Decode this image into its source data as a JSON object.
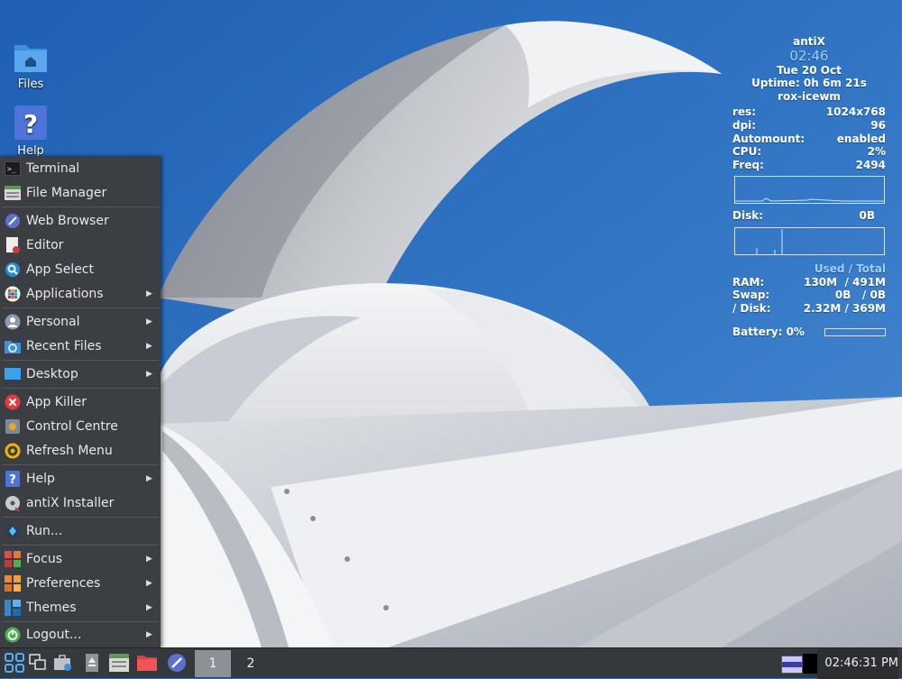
{
  "desktop": {
    "icons": [
      {
        "label": "Files",
        "icon": "folder-home-icon"
      },
      {
        "label": "Help",
        "icon": "help-icon"
      }
    ]
  },
  "conky": {
    "hostname": "antiX",
    "time": "02:46",
    "date": "Tue 20 Oct",
    "uptime": "Uptime: 0h 6m 21s",
    "wm": "rox-icewm",
    "stats": [
      {
        "label": "res:",
        "value": "1024x768"
      },
      {
        "label": "dpi:",
        "value": "96"
      },
      {
        "label": "Automount:",
        "value": "enabled"
      },
      {
        "label": "CPU:",
        "value": "2%"
      },
      {
        "label": "Freq:",
        "value": "2494"
      }
    ],
    "disk": {
      "label": "Disk:",
      "value": "0B"
    },
    "used_total": "Used / Total",
    "memory": [
      {
        "label": "RAM:",
        "value": "130M  / 491M"
      },
      {
        "label": "Swap:",
        "value": "0B   / 0B"
      },
      {
        "label": "/ Disk:",
        "value": "2.32M / 369M"
      }
    ],
    "battery": {
      "label": "Battery: 0%",
      "level": 0
    }
  },
  "menu": {
    "items": [
      {
        "label": "Terminal",
        "icon": "terminal-icon",
        "submenu": false
      },
      {
        "label": "File Manager",
        "icon": "file-manager-icon",
        "submenu": false
      },
      {
        "label": "Web Browser",
        "icon": "web-browser-icon",
        "submenu": false
      },
      {
        "label": "Editor",
        "icon": "editor-icon",
        "submenu": false
      },
      {
        "label": "App Select",
        "icon": "app-select-icon",
        "submenu": false
      },
      {
        "label": "Applications",
        "icon": "applications-icon",
        "submenu": true
      },
      {
        "label": "Personal",
        "icon": "personal-icon",
        "submenu": true
      },
      {
        "label": "Recent Files",
        "icon": "recent-files-icon",
        "submenu": true
      },
      {
        "label": "Desktop",
        "icon": "desktop-icon",
        "submenu": true
      },
      {
        "label": "App Killer",
        "icon": "app-killer-icon",
        "submenu": false
      },
      {
        "label": "Control Centre",
        "icon": "control-centre-icon",
        "submenu": false
      },
      {
        "label": "Refresh Menu",
        "icon": "refresh-menu-icon",
        "submenu": false
      },
      {
        "label": "Help",
        "icon": "help-icon",
        "submenu": true
      },
      {
        "label": "antiX Installer",
        "icon": "installer-icon",
        "submenu": false
      },
      {
        "label": "Run...",
        "icon": "run-icon",
        "submenu": false
      },
      {
        "label": "Focus",
        "icon": "focus-icon",
        "submenu": true
      },
      {
        "label": "Preferences",
        "icon": "preferences-icon",
        "submenu": true
      },
      {
        "label": "Themes",
        "icon": "themes-icon",
        "submenu": true
      },
      {
        "label": "Logout...",
        "icon": "logout-icon",
        "submenu": true
      }
    ]
  },
  "taskbar": {
    "workspaces": [
      "1",
      "2"
    ],
    "active_workspace": "1",
    "clock": "02:46:31 PM"
  },
  "colors": {
    "sky": "#2f6fbd",
    "menu_bg": "#3b3e42",
    "taskbar_bg": "#35383c",
    "conky_accent": "#9fd0ff"
  }
}
